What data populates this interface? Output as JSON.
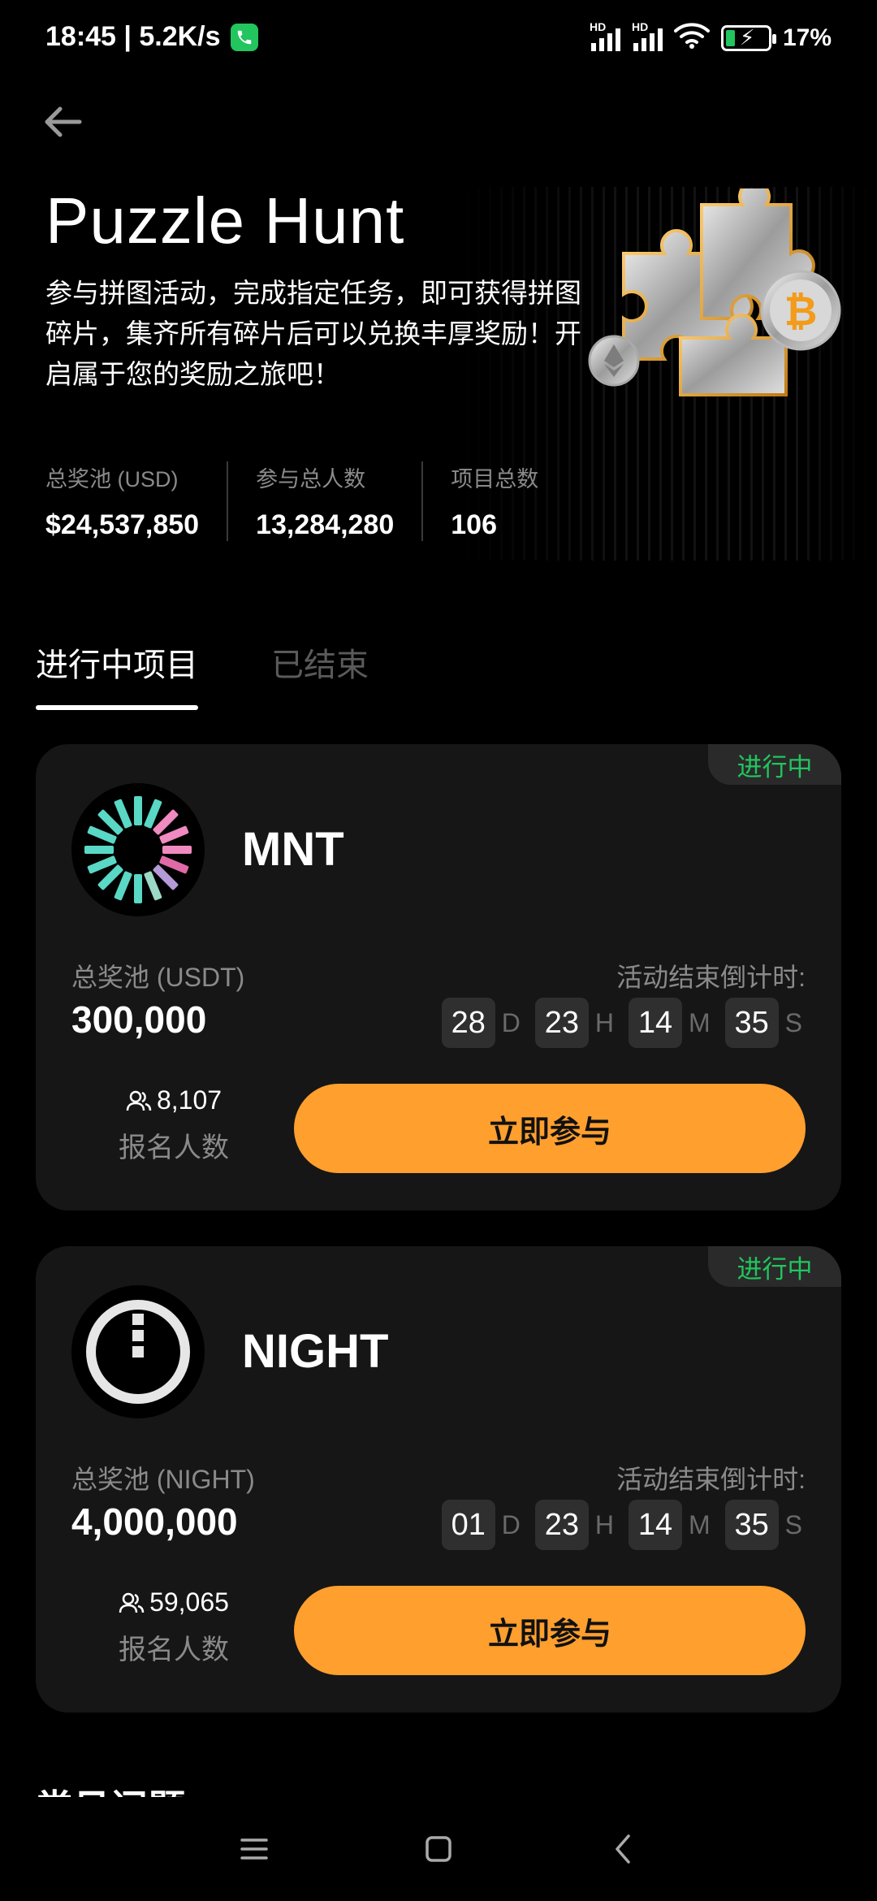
{
  "status_bar": {
    "time": "18:45 | 5.2K/s",
    "battery": "17%"
  },
  "hero": {
    "title": "Puzzle Hunt",
    "description": "参与拼图活动，完成指定任务，即可获得拼图碎片，集齐所有碎片后可以兑换丰厚奖励！开启属于您的奖励之旅吧！"
  },
  "stats": [
    {
      "label": "总奖池 (USD)",
      "value": "$24,537,850"
    },
    {
      "label": "参与总人数",
      "value": "13,284,280"
    },
    {
      "label": "项目总数",
      "value": "106"
    }
  ],
  "tabs": {
    "active": "进行中项目",
    "inactive": "已结束"
  },
  "projects": [
    {
      "status": "进行中",
      "name": "MNT",
      "pool_label": "总奖池 (USDT)",
      "pool_value": "300,000",
      "countdown_label": "活动结束倒计时:",
      "countdown": {
        "d": "28",
        "h": "23",
        "m": "14",
        "s": "35"
      },
      "registrants": "8,107",
      "registrants_label": "报名人数",
      "join_label": "立即参与"
    },
    {
      "status": "进行中",
      "name": "NIGHT",
      "pool_label": "总奖池 (NIGHT)",
      "pool_value": "4,000,000",
      "countdown_label": "活动结束倒计时:",
      "countdown": {
        "d": "01",
        "h": "23",
        "m": "14",
        "s": "35"
      },
      "registrants": "59,065",
      "registrants_label": "报名人数",
      "join_label": "立即参与"
    }
  ],
  "countdown_units": {
    "d": "D",
    "h": "H",
    "m": "M",
    "s": "S"
  },
  "faq": {
    "title": "常见问题"
  },
  "colors": {
    "accent": "#ff9f2e",
    "status_green": "#22c55e",
    "card_bg": "#161616"
  },
  "icons": [
    "back-arrow-icon",
    "users-icon",
    "menu-icon",
    "home-icon",
    "nav-back-icon"
  ]
}
